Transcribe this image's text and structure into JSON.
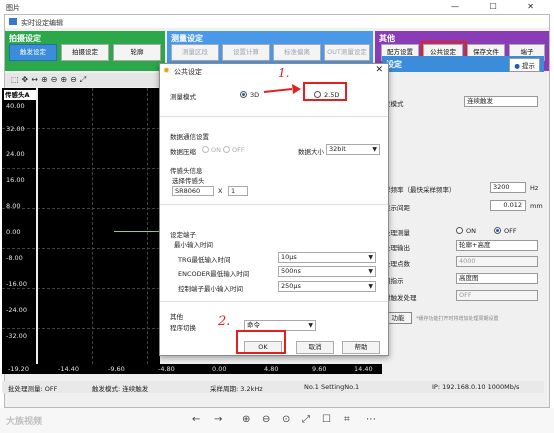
{
  "outer": {
    "title": "图片",
    "controls": [
      "—",
      "☐",
      "✕"
    ]
  },
  "app": {
    "title": "实时设定编辑"
  },
  "groups": [
    {
      "title": "拍摄设定",
      "color": "#2ca84a",
      "buttons": [
        "触发设定",
        "拍摄设定",
        "轮廓"
      ]
    },
    {
      "title": "测量设定",
      "color": "#4a98e8",
      "buttons": [
        "测量区段",
        "设置计算",
        "标准偏离",
        "OUT测量设定"
      ]
    },
    {
      "title": "其他",
      "color": "#8a3cb6",
      "buttons": [
        "配方设置",
        "公共设定",
        "保存文件",
        "端子"
      ]
    }
  ],
  "display": {
    "head_label": "传感头A",
    "y_labels": [
      "40.00",
      "32.00",
      "24.00",
      "16.00",
      "8.00",
      "0.00",
      "-8.00",
      "-16.00",
      "-24.00",
      "-32.00"
    ],
    "x_labels": [
      "-19.20",
      "-14.40",
      "-9.60",
      "-4.80",
      "0.00",
      "4.80",
      "9.60",
      "14.40"
    ]
  },
  "right_panel": {
    "header": "设定",
    "help_label": "提示",
    "rows": [
      {
        "label": "发模式",
        "value": "连续触发"
      },
      {
        "label": "样频率（最快采样频率）",
        "value": "3200",
        "unit": "Hz"
      },
      {
        "label": "显示间距",
        "value": "0.012",
        "unit": "mm"
      },
      {
        "label": "处理测量",
        "on": "ON",
        "off": "OFF"
      },
      {
        "label": "处理输出",
        "value": "轮廓+高度"
      },
      {
        "label": "处理点数",
        "value": "4000"
      },
      {
        "label": "图指示",
        "value": "高度图"
      },
      {
        "label": "时触发处理",
        "value": "OFF"
      }
    ],
    "func_label": "功能",
    "func_note": "*缓存功能打开时将增加处理周期设置"
  },
  "status": {
    "batch": "批处理测量: OFF",
    "trigger": "触发模式: 连续触发",
    "sample": "采样周期: 3.2kHz",
    "setting": "No.1 SettingNo.1",
    "ip": "IP: 192.168.0.10 1000Mb/s"
  },
  "viewer": {
    "watermark": "大族视频",
    "icons": [
      "←",
      "→",
      "⊕",
      "⊖",
      "⊙",
      "⤢",
      "☐",
      "⌗",
      "⋯"
    ]
  },
  "dialog": {
    "title": "公共设定",
    "measure_mode_label": "测量模式",
    "mode_3d": "3D",
    "mode_25d": "2.5D",
    "comm_title": "数据通信设置",
    "compress_label": "数据压缩",
    "compress_on": "ON",
    "compress_off": "OFF",
    "size_label": "数据大小",
    "size_value": "32bit",
    "sensor_title": "传感头信息",
    "select_label": "选择传感头",
    "sensor_model": "SR8060",
    "sensor_x": "X",
    "sensor_count": "1",
    "terminal_title": "设定端子",
    "min_input_title": "最小输入时间",
    "trg_label": "TRG最低输入时间",
    "trg_value": "10μs",
    "enc_label": "ENCODER最低输入时间",
    "enc_value": "500ns",
    "ctrl_label": "控制端子最小输入时间",
    "ctrl_value": "250μs",
    "other_title": "其他",
    "switch_label": "程序切换",
    "switch_value": "命令",
    "ok": "OK",
    "cancel": "取消",
    "help": "帮助"
  },
  "annotations": {
    "one": "1.",
    "two": "2."
  }
}
